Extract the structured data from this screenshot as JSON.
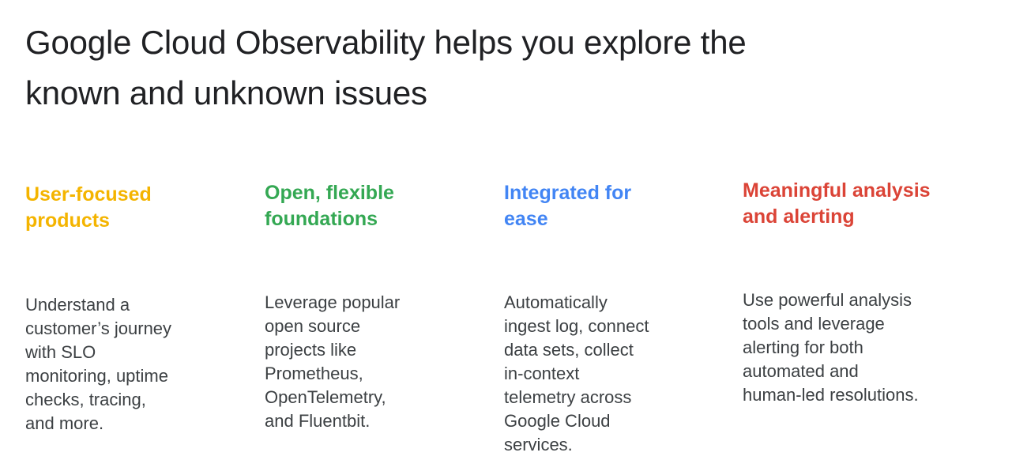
{
  "slide": {
    "title": "Google Cloud Observability helps you explore the\nknown and unknown issues",
    "columns": [
      {
        "heading": "User-focused\nproducts",
        "color": "#F4B400",
        "body": "Understand a\ncustomer’s journey\nwith SLO\nmonitoring, uptime\nchecks, tracing,\nand more."
      },
      {
        "heading": "Open, flexible\nfoundations",
        "color": "#34A853",
        "body": "Leverage popular\nopen source\nprojects like\nPrometheus,\nOpenTelemetry,\nand Fluentbit."
      },
      {
        "heading": "Integrated for\nease",
        "color": "#4285F4",
        "body": "Automatically\ningest log, connect\ndata sets, collect\nin-context\ntelemetry across\nGoogle Cloud\nservices."
      },
      {
        "heading": "Meaningful analysis\nand alerting",
        "color": "#DB4437",
        "body": "Use powerful analysis\ntools and leverage\nalerting for both\nautomated and\nhuman-led resolutions."
      }
    ]
  }
}
